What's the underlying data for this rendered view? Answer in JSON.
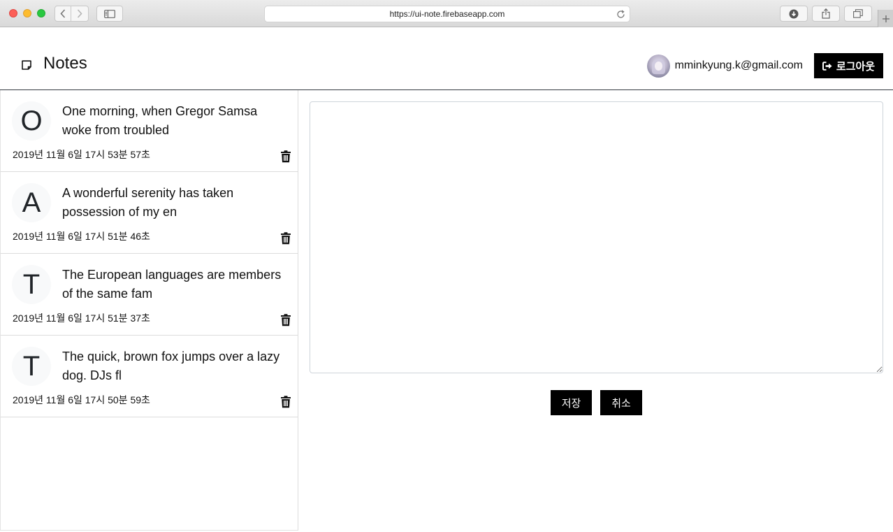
{
  "browser": {
    "url": "https://ui-note.firebaseapp.com"
  },
  "header": {
    "title": "Notes",
    "user_email": "mminkyung.k@gmail.com",
    "logout_label": "로그아웃"
  },
  "notes": [
    {
      "letter": "O",
      "text": "One morning, when Gregor Samsa woke from troubled",
      "date": "2019년 11월 6일 17시 53분 57초"
    },
    {
      "letter": "A",
      "text": "A wonderful serenity has taken possession of my en",
      "date": "2019년 11월 6일 17시 51분 46초"
    },
    {
      "letter": "T",
      "text": "The European languages are members of the same fam",
      "date": "2019년 11월 6일 17시 51분 37초"
    },
    {
      "letter": "T",
      "text": "The quick, brown fox jumps over a lazy dog. DJs fl",
      "date": "2019년 11월 6일 17시 50분 59초"
    }
  ],
  "editor": {
    "content": "",
    "save_label": "저장",
    "cancel_label": "취소"
  },
  "icons": {
    "brand": "sticky-note-icon",
    "logout": "sign-out-icon",
    "delete": "trash-icon"
  }
}
